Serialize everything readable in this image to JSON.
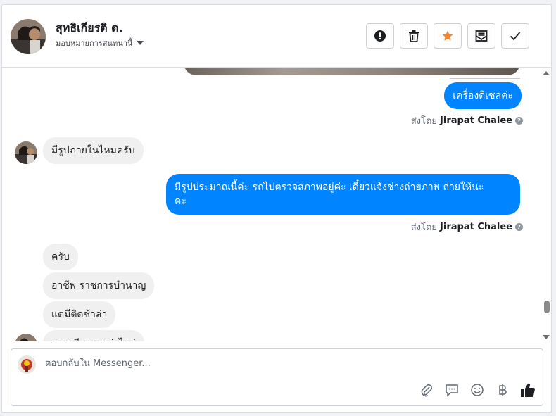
{
  "header": {
    "contact_name": "สุทธิเกียรติ ด.",
    "assign_label": "มอบหมายการสนทนานี้",
    "actions": [
      {
        "name": "mark-spam-button",
        "icon": "alert-icon"
      },
      {
        "name": "delete-button",
        "icon": "trash-icon"
      },
      {
        "name": "star-button",
        "icon": "star-icon"
      },
      {
        "name": "mark-unread-button",
        "icon": "envelope-icon"
      },
      {
        "name": "mark-done-button",
        "icon": "check-icon"
      }
    ]
  },
  "messages": {
    "out_1": "เครื่องดีเซลค่ะ",
    "sent_by_1": {
      "prefix": "ส่งโดย",
      "name": "Jirapat Chalee"
    },
    "in_1": "มีรูปภายในไหมครับ",
    "out_2_line1": "มีรูปประมาณนี้ค่ะ รถไปตรวจสภาพอยู่ค่ะ เดี๋ยวแจ้งช่างถ่ายภาพ ถ่ายให้นะ",
    "out_2_line2": "คะ",
    "sent_by_2": {
      "prefix": "ส่งโดย",
      "name": "Jirapat Chalee"
    },
    "in_2": "ครับ",
    "in_3": "อาชีพ ราชการบำนาญ",
    "in_4": "แต่มีติดช้าล่า",
    "in_5": "ผ่อนเดือนละเท่าไหร่"
  },
  "composer": {
    "placeholder": "ตอบกลับใน Messenger...",
    "tools": [
      "paperclip-icon",
      "comment-icon",
      "smiley-icon",
      "baht-icon",
      "thumbs-up-icon"
    ]
  },
  "colors": {
    "accent": "#0084ff",
    "star": "#f5822a",
    "incoming_bubble": "#f0f0f0"
  }
}
